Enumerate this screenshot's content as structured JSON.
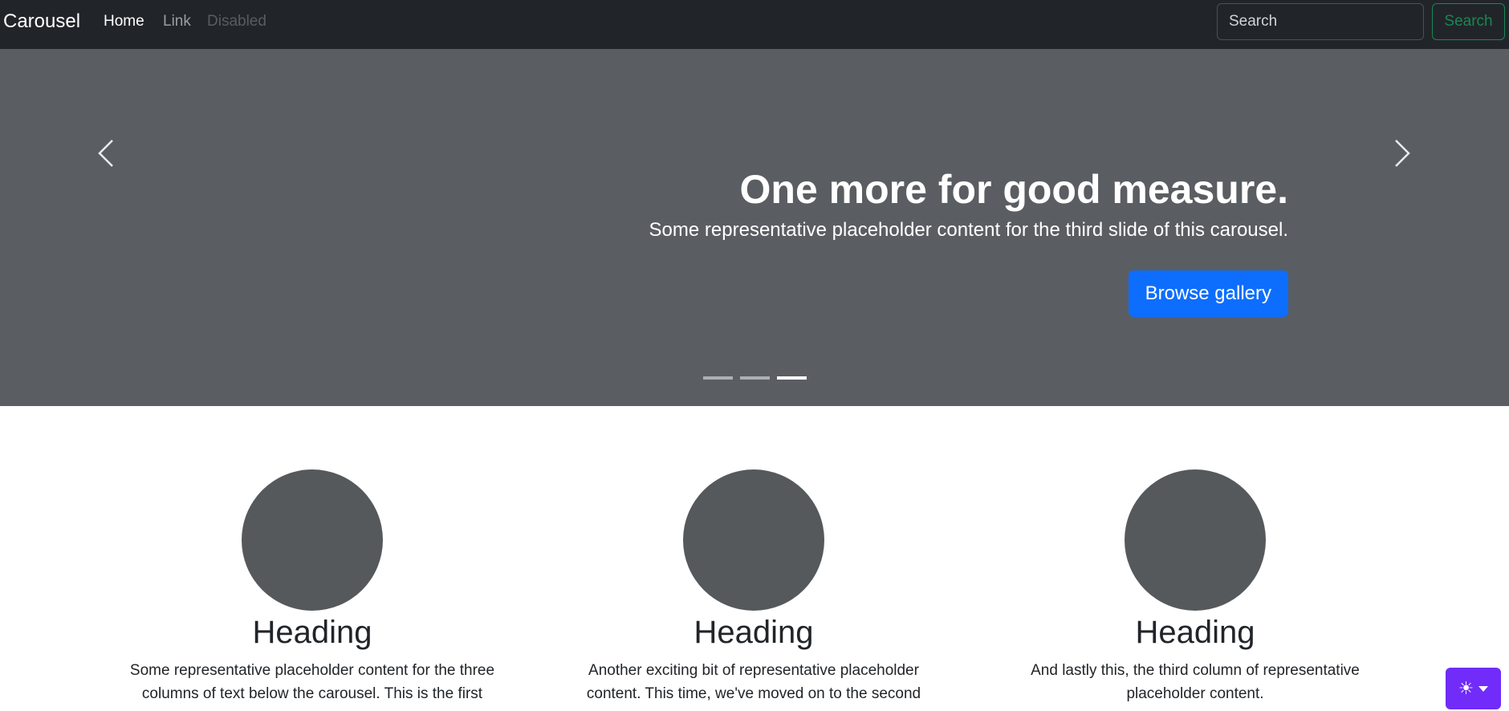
{
  "navbar": {
    "brand": "Carousel",
    "links": [
      {
        "label": "Home",
        "state": "active"
      },
      {
        "label": "Link",
        "state": "normal"
      },
      {
        "label": "Disabled",
        "state": "disabled"
      }
    ],
    "search": {
      "placeholder": "Search",
      "value": ""
    },
    "search_button": "Search"
  },
  "carousel": {
    "active_slide": 3,
    "slide_count": 3,
    "caption": {
      "title": "One more for good measure.",
      "text": "Some representative placeholder content for the third slide of this carousel.",
      "button": "Browse gallery"
    },
    "prev_icon": "chevron-left-icon",
    "next_icon": "chevron-right-icon"
  },
  "columns": [
    {
      "heading": "Heading",
      "text": "Some representative placeholder content for the three columns of text below the carousel. This is the first"
    },
    {
      "heading": "Heading",
      "text": "Another exciting bit of representative placeholder content. This time, we've moved on to the second"
    },
    {
      "heading": "Heading",
      "text": "And lastly this, the third column of representative placeholder content."
    }
  ],
  "theme_toggle": {
    "icon": "sun-icon",
    "caret": "caret-down-icon"
  },
  "colors": {
    "navbar_bg": "#212529",
    "carousel_bg": "#5a5e62",
    "primary": "#0d6efd",
    "success": "#198754",
    "theme_toggle": "#712cf9",
    "placeholder_circle": "#55595c"
  }
}
